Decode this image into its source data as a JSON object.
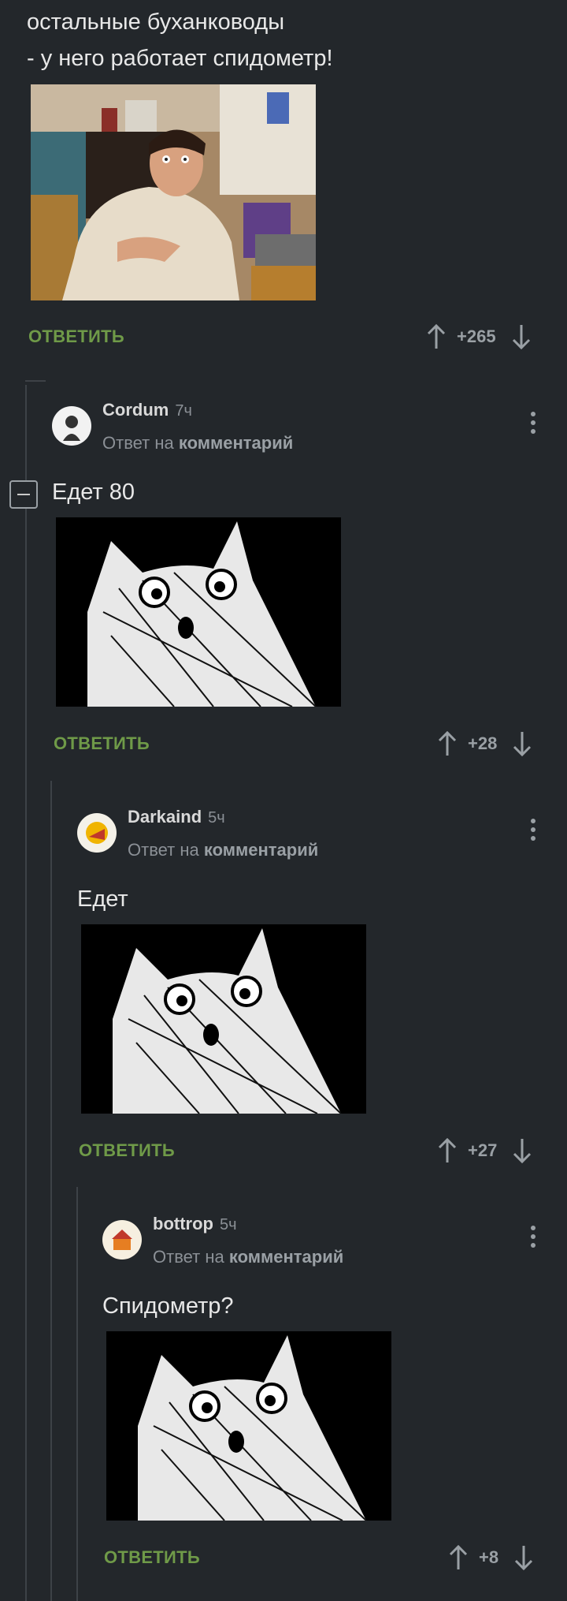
{
  "top_comment": {
    "text_line1": "остальные буханководы",
    "text_line2": "- у него работает спидометр!",
    "reply_label": "ОТВЕТИТЬ",
    "score": "+265"
  },
  "comments": [
    {
      "user": "Cordum",
      "time": "7ч",
      "reply_prefix": "Ответ на",
      "reply_target": "комментарий",
      "text": "Едет 80",
      "reply_label": "ОТВЕТИТЬ",
      "score": "+28"
    },
    {
      "user": "Darkaind",
      "time": "5ч",
      "reply_prefix": "Ответ на",
      "reply_target": "комментарий",
      "text": "Едет",
      "reply_label": "ОТВЕТИТЬ",
      "score": "+27"
    },
    {
      "user": "bottrop",
      "time": "5ч",
      "reply_prefix": "Ответ на",
      "reply_target": "комментарий",
      "text": "Спидометр?",
      "reply_label": "ОТВЕТИТЬ",
      "score": "+8"
    }
  ],
  "colors": {
    "background": "#23272b",
    "reply_green": "#6f9a48",
    "muted": "#8b9096"
  }
}
